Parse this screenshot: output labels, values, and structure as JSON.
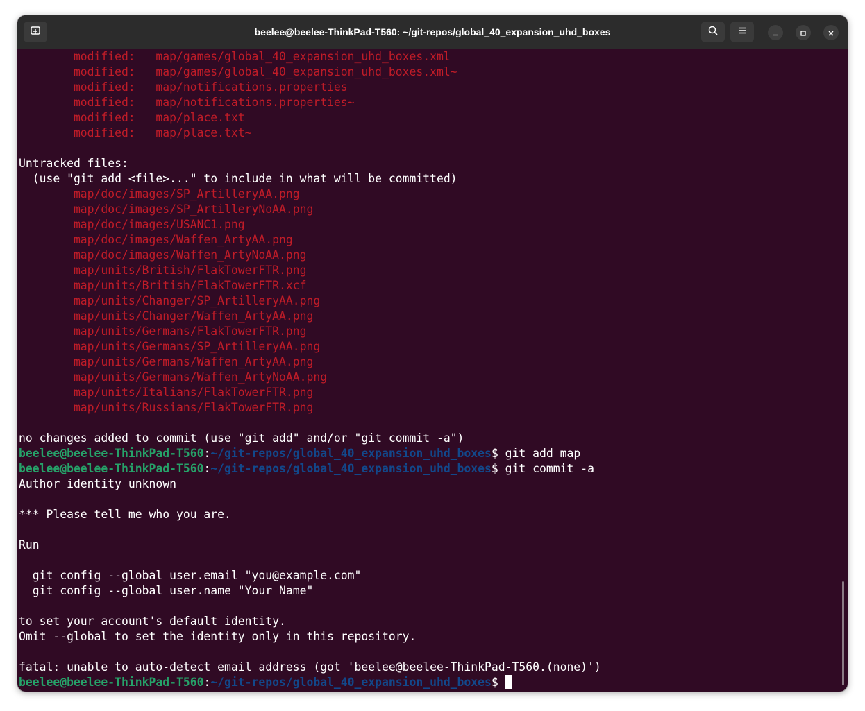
{
  "window": {
    "title": "beelee@beelee-ThinkPad-T560: ~/git-repos/global_40_expansion_uhd_boxes"
  },
  "icons": {
    "new_tab": "new-tab-icon",
    "search": "search-icon",
    "menu": "hamburger-menu-icon",
    "minimize": "minimize-icon",
    "maximize": "maximize-icon",
    "close": "close-icon"
  },
  "colors": {
    "background": "#300a24",
    "modified_text": "#c01c28",
    "prompt_user": "#26a269",
    "prompt_path": "#12488b"
  },
  "terminal": {
    "lines": [
      {
        "kind": "red",
        "text": "        modified:   map/games/global_40_expansion_uhd_boxes.xml"
      },
      {
        "kind": "red",
        "text": "        modified:   map/games/global_40_expansion_uhd_boxes.xml~"
      },
      {
        "kind": "red",
        "text": "        modified:   map/notifications.properties"
      },
      {
        "kind": "red",
        "text": "        modified:   map/notifications.properties~"
      },
      {
        "kind": "red",
        "text": "        modified:   map/place.txt"
      },
      {
        "kind": "red",
        "text": "        modified:   map/place.txt~"
      },
      {
        "kind": "plain",
        "text": ""
      },
      {
        "kind": "plain",
        "text": "Untracked files:"
      },
      {
        "kind": "plain",
        "text": "  (use \"git add <file>...\" to include in what will be committed)"
      },
      {
        "kind": "red",
        "text": "        map/doc/images/SP_ArtilleryAA.png"
      },
      {
        "kind": "red",
        "text": "        map/doc/images/SP_ArtilleryNoAA.png"
      },
      {
        "kind": "red",
        "text": "        map/doc/images/USANC1.png"
      },
      {
        "kind": "red",
        "text": "        map/doc/images/Waffen_ArtyAA.png"
      },
      {
        "kind": "red",
        "text": "        map/doc/images/Waffen_ArtyNoAA.png"
      },
      {
        "kind": "red",
        "text": "        map/units/British/FlakTowerFTR.png"
      },
      {
        "kind": "red",
        "text": "        map/units/British/FlakTowerFTR.xcf"
      },
      {
        "kind": "red",
        "text": "        map/units/Changer/SP_ArtilleryAA.png"
      },
      {
        "kind": "red",
        "text": "        map/units/Changer/Waffen_ArtyAA.png"
      },
      {
        "kind": "red",
        "text": "        map/units/Germans/FlakTowerFTR.png"
      },
      {
        "kind": "red",
        "text": "        map/units/Germans/SP_ArtilleryAA.png"
      },
      {
        "kind": "red",
        "text": "        map/units/Germans/Waffen_ArtyAA.png"
      },
      {
        "kind": "red",
        "text": "        map/units/Germans/Waffen_ArtyNoAA.png"
      },
      {
        "kind": "red",
        "text": "        map/units/Italians/FlakTowerFTR.png"
      },
      {
        "kind": "red",
        "text": "        map/units/Russians/FlakTowerFTR.png"
      },
      {
        "kind": "plain",
        "text": ""
      },
      {
        "kind": "plain",
        "text": "no changes added to commit (use \"git add\" and/or \"git commit -a\")"
      },
      {
        "kind": "prompt",
        "user": "beelee@beelee-ThinkPad-T560",
        "sep": ":",
        "path": "~/git-repos/global_40_expansion_uhd_boxes",
        "dollar": "$ ",
        "cmd": "git add map"
      },
      {
        "kind": "prompt",
        "user": "beelee@beelee-ThinkPad-T560",
        "sep": ":",
        "path": "~/git-repos/global_40_expansion_uhd_boxes",
        "dollar": "$ ",
        "cmd": "git commit -a"
      },
      {
        "kind": "plain",
        "text": "Author identity unknown"
      },
      {
        "kind": "plain",
        "text": ""
      },
      {
        "kind": "plain",
        "text": "*** Please tell me who you are."
      },
      {
        "kind": "plain",
        "text": ""
      },
      {
        "kind": "plain",
        "text": "Run"
      },
      {
        "kind": "plain",
        "text": ""
      },
      {
        "kind": "plain",
        "text": "  git config --global user.email \"you@example.com\""
      },
      {
        "kind": "plain",
        "text": "  git config --global user.name \"Your Name\""
      },
      {
        "kind": "plain",
        "text": ""
      },
      {
        "kind": "plain",
        "text": "to set your account's default identity."
      },
      {
        "kind": "plain",
        "text": "Omit --global to set the identity only in this repository."
      },
      {
        "kind": "plain",
        "text": ""
      },
      {
        "kind": "plain",
        "text": "fatal: unable to auto-detect email address (got 'beelee@beelee-ThinkPad-T560.(none)')"
      },
      {
        "kind": "prompt",
        "user": "beelee@beelee-ThinkPad-T560",
        "sep": ":",
        "path": "~/git-repos/global_40_expansion_uhd_boxes",
        "dollar": "$ ",
        "cmd": "",
        "cursor": true
      }
    ]
  }
}
